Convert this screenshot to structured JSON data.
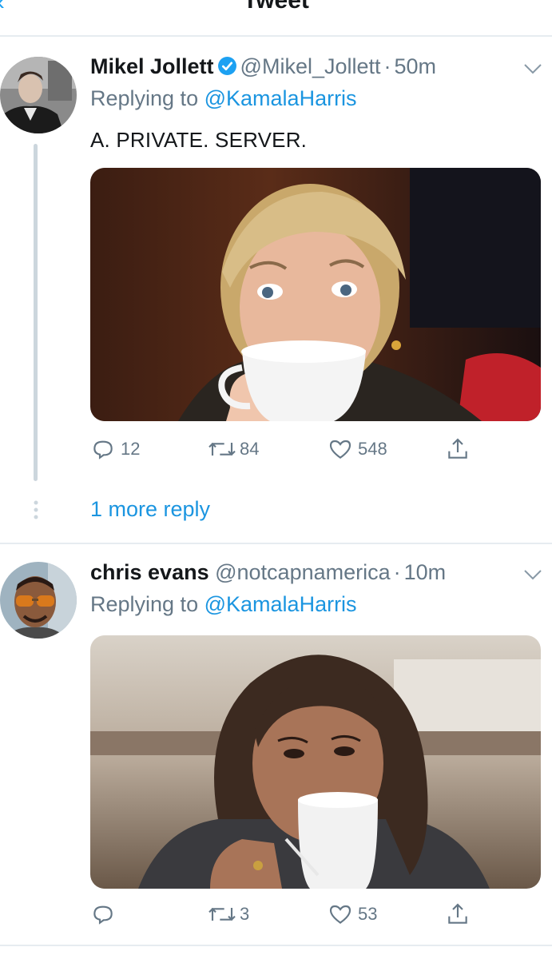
{
  "header": {
    "back_icon": "back-arrow-icon",
    "title": "Tweet"
  },
  "tweets": [
    {
      "name": "Mikel Jollett",
      "verified": true,
      "handle": "@Mikel_Jollett",
      "separator": "·",
      "time": "50m",
      "replying_prefix": "Replying to",
      "replying_to": "@KamalaHarris",
      "text": "A. PRIVATE. SERVER.",
      "actions": {
        "replies": "12",
        "retweets": "84",
        "likes": "548"
      }
    },
    {
      "name": "chris evans",
      "verified": false,
      "handle": "@notcapnamerica",
      "separator": "·",
      "time": "10m",
      "replying_prefix": "Replying to",
      "replying_to": "@KamalaHarris",
      "text": "",
      "actions": {
        "replies": "",
        "retweets": "3",
        "likes": "53"
      }
    }
  ],
  "thread": {
    "more_replies": "1 more reply"
  },
  "colors": {
    "accent": "#1b95e0",
    "muted": "#657786",
    "divider": "#e6ecf0",
    "thread_line": "#ccd6dd"
  }
}
